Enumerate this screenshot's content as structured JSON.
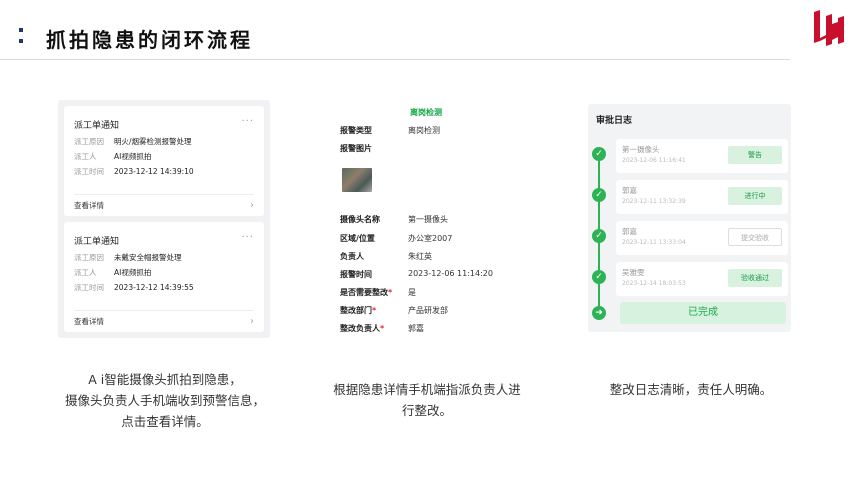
{
  "header": {
    "title": "抓拍隐患的闭环流程"
  },
  "panel1": {
    "notices": [
      {
        "title": "派工单通知",
        "more": "···",
        "rows": [
          {
            "k": "派工原因",
            "v": "明火/烟雾检测报警处理"
          },
          {
            "k": "派工人",
            "v": "AI视频抓拍"
          },
          {
            "k": "派工时间",
            "v": "2023-12-12 14:39:10"
          }
        ],
        "link": "查看详情"
      },
      {
        "title": "派工单通知",
        "more": "···",
        "rows": [
          {
            "k": "派工原因",
            "v": "未戴安全帽报警处理"
          },
          {
            "k": "派工人",
            "v": "AI视频抓拍"
          },
          {
            "k": "派工时间",
            "v": "2023-12-12 14:39:55"
          }
        ],
        "link": "查看详情"
      }
    ]
  },
  "panel2": {
    "head": "离岗检测",
    "alarm_type_k": "报警类型",
    "alarm_type_v": "离岗检测",
    "alarm_image_k": "报警图片",
    "camera_k": "摄像头名称",
    "camera_v": "第一摄像头",
    "area_k": "区域/位置",
    "area_v": "办公室2007",
    "owner_k": "负责人",
    "owner_v": "朱红英",
    "time_k": "报警时间",
    "time_v": "2023-12-06 11:14:20",
    "need_k": "是否需要整改",
    "need_v": "是",
    "dept_k": "整改部门",
    "dept_v": "产品研发部",
    "rect_k": "整改负责人",
    "rect_v": "郭嘉",
    "req": "*"
  },
  "panel3": {
    "title": "审批日志",
    "entries": [
      {
        "name": "第一摄像头",
        "time": "2023-12-06 11:16:41",
        "tag": "警告",
        "style": "green"
      },
      {
        "name": "郭嘉",
        "time": "2023-12-11 13:32:39",
        "tag": "进行中",
        "style": "green"
      },
      {
        "name": "郭嘉",
        "time": "2023-12-11 13:33:04",
        "tag": "提交验收",
        "style": "gray"
      },
      {
        "name": "吴雅雯",
        "time": "2023-12-14 18:03:53",
        "tag": "验收通过",
        "style": "green"
      }
    ],
    "done": "已完成"
  },
  "captions": {
    "c1_l1": "A i智能摄像头抓拍到隐患，",
    "c1_l2": "摄像头负责人手机端收到预警信息，",
    "c1_l3": "点击查看详情。",
    "c2_l1": "根据隐患详情手机端指派负责人进",
    "c2_l2": "行整改。",
    "c3_l1": "整改日志清晰，责任人明确。"
  },
  "colors": {
    "accent_green": "#2db356",
    "title_dot": "#1b3a6b",
    "logo_red": "#c8102e"
  }
}
